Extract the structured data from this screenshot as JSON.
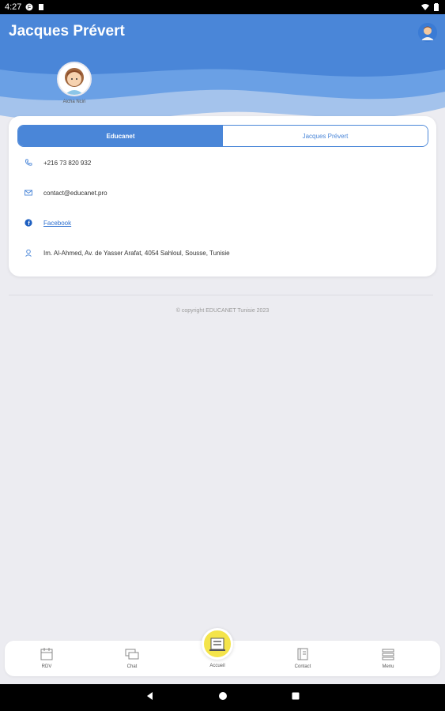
{
  "status": {
    "time": "4:27"
  },
  "header": {
    "title": "Jacques Prévert",
    "child_name": "Aicha Nciri"
  },
  "tabs": [
    {
      "label": "Educanet"
    },
    {
      "label": "Jacques Prévert"
    }
  ],
  "contact": {
    "phone": "+216 73 820 932",
    "email": "contact@educanet.pro",
    "facebook": "Facebook",
    "address": "Im. Al-Ahmed, Av. de Yasser Arafat, 4054 Sahloul, Sousse, Tunisie"
  },
  "footer": {
    "copyright": "© copyright EDUCANET Tunisie 2023"
  },
  "nav": {
    "rdv": "RDV",
    "chat": "Chat",
    "accueil": "Accueil",
    "contact": "Contact",
    "menu": "Menu"
  },
  "colors": {
    "accent": "#4a86d8",
    "center_button": "#f4e44a",
    "background": "#ececf1"
  }
}
